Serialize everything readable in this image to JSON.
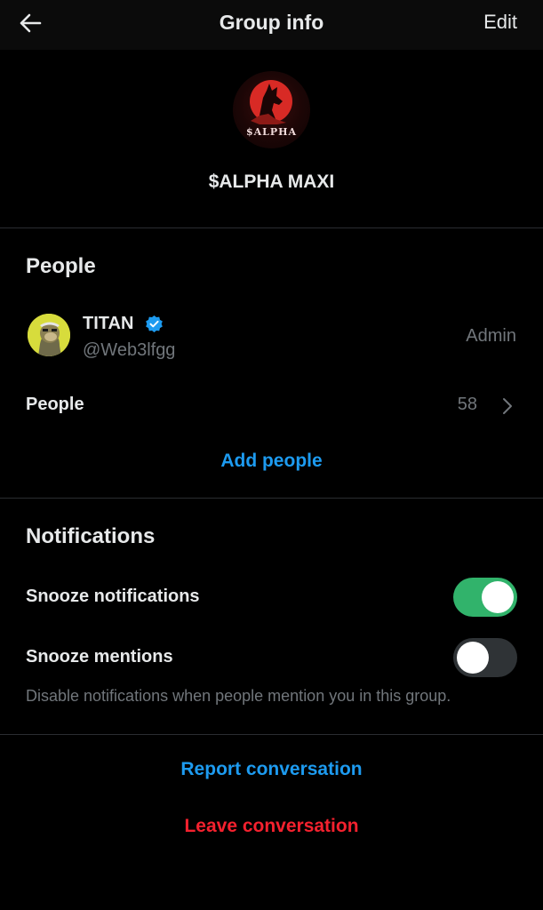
{
  "header": {
    "title": "Group info",
    "edit_label": "Edit",
    "back_icon": "arrow-left-icon"
  },
  "group": {
    "avatar_text": "$ALPHA",
    "name": "$ALPHA MAXI"
  },
  "people_section": {
    "title": "People",
    "member": {
      "name": "TITAN",
      "handle": "@Web3lfgg",
      "role": "Admin",
      "verified": true
    },
    "people_row": {
      "label": "People",
      "count": "58"
    },
    "add_people_label": "Add people"
  },
  "notifications_section": {
    "title": "Notifications",
    "snooze_notifications": {
      "label": "Snooze notifications",
      "enabled": true
    },
    "snooze_mentions": {
      "label": "Snooze mentions",
      "enabled": false
    },
    "hint": "Disable notifications when people mention you in this group."
  },
  "actions": {
    "report_label": "Report conversation",
    "leave_label": "Leave conversation"
  },
  "colors": {
    "background": "#000000",
    "accent_blue": "#1d9bf0",
    "danger_red": "#f4212e",
    "toggle_on": "#31b36b",
    "toggle_off": "#2f3336",
    "secondary_text": "#71767b"
  }
}
